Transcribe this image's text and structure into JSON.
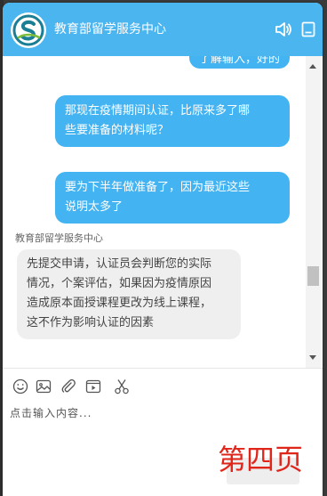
{
  "header": {
    "title": "教育部留学服务中心",
    "accent_color": "#4bb5f0"
  },
  "messages": {
    "partial_out": "了解输入，好的",
    "out_1": [
      "那现在疫情期间认证，比原来多了哪",
      "些要准备的材料呢？"
    ],
    "out_2": [
      "要为下半年做准备了，因为最近这些",
      "说明太多了"
    ],
    "in_sender": "教育部留学服务中心",
    "in_1": [
      "先提交申请，认证员会判断您的实际",
      "情况，个案评估，如果因为疫情原因",
      "造成原本面授课程更改为线上课程，",
      "这不作为影响认证的因素"
    ]
  },
  "composer": {
    "placeholder": "点击输入内容...",
    "tools": [
      "smile-icon",
      "image-icon",
      "attachment-icon",
      "video-icon",
      "scissors-icon"
    ]
  },
  "overlay": {
    "page_label": "第四页"
  }
}
